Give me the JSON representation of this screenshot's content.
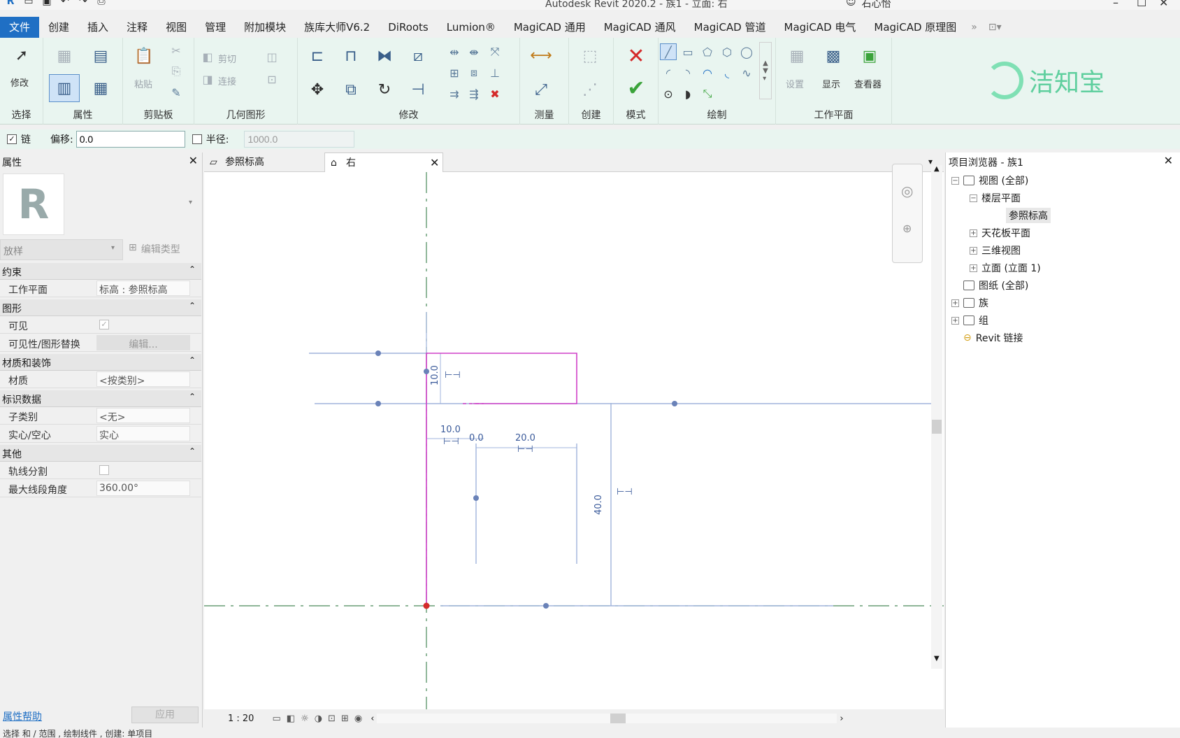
{
  "titlebar": {
    "title": "Autodesk Revit 2020.2 - 族1 - 立面: 右",
    "user": "石心怡"
  },
  "menu": {
    "tabs": [
      "文件",
      "创建",
      "插入",
      "注释",
      "视图",
      "管理",
      "附加模块",
      "族库大师V6.2",
      "DiRoots",
      "Lumion®",
      "MagiCAD 通用",
      "MagiCAD 通风",
      "MagiCAD 管道",
      "MagiCAD 电气",
      "MagiCAD 原理图"
    ]
  },
  "ribbon": {
    "groups": {
      "select": "选择",
      "properties": "属性",
      "clipboard": "剪贴板",
      "geometry": "几何图形",
      "modify": "修改",
      "measure": "测量",
      "create": "创建",
      "mode": "模式",
      "draw": "绘制",
      "workplane": "工作平面"
    },
    "labels": {
      "modify": "修改",
      "paste": "粘贴",
      "cut": "剪切",
      "join": "连接",
      "set": "设置",
      "show": "显示",
      "viewer": "查看器"
    },
    "watermark": "洁知宝"
  },
  "options": {
    "chain_label": "链",
    "offset_label": "偏移:",
    "offset_value": "0.0",
    "radius_label": "半径:",
    "radius_value": "1000.0"
  },
  "properties": {
    "title": "属性",
    "type_name": "放样",
    "edit_type": "编辑类型",
    "sections": {
      "constraints": "约束",
      "graphics": "图形",
      "materials": "材质和装饰",
      "identity": "标识数据",
      "other": "其他"
    },
    "rows": {
      "workplane_k": "工作平面",
      "workplane_v": "标高 : 参照标高",
      "visible_k": "可见",
      "vis_override_k": "可见性/图形替换",
      "vis_override_v": "编辑...",
      "material_k": "材质",
      "material_v": "<按类别>",
      "subcategory_k": "子类别",
      "subcategory_v": "<无>",
      "solid_k": "实心/空心",
      "solid_v": "实心",
      "trajectory_k": "轨线分割",
      "maxangle_k": "最大线段角度",
      "maxangle_v": "360.00°"
    },
    "help": "属性帮助",
    "apply": "应用"
  },
  "views": {
    "tab1": "参照标高",
    "tab2": "右"
  },
  "canvas": {
    "dims": {
      "d1": "10.0",
      "d2": "10.0",
      "d3": "0.0",
      "d4": "20.0",
      "d5": "40.0"
    }
  },
  "viewbar": {
    "scale": "1 : 20"
  },
  "browser": {
    "title": "项目浏览器 - 族1",
    "nodes": {
      "views": "视图 (全部)",
      "floorplans": "楼层平面",
      "reflevel": "参照标高",
      "ceiling": "天花板平面",
      "threed": "三维视图",
      "elevations": "立面 (立面 1)",
      "sheets": "图纸 (全部)",
      "families": "族",
      "groups": "组",
      "links": "Revit 链接"
    }
  },
  "status": {
    "text": "选择 和 / 范围 , 绘制线件 , 创建: 单项目"
  },
  "colors": {
    "accent": "#1f6fc4",
    "ribbon_bg": "#e9f5f0",
    "sketch": "#d040c8",
    "refline": "#a0b4dc",
    "dimension": "#3a5a9a"
  }
}
